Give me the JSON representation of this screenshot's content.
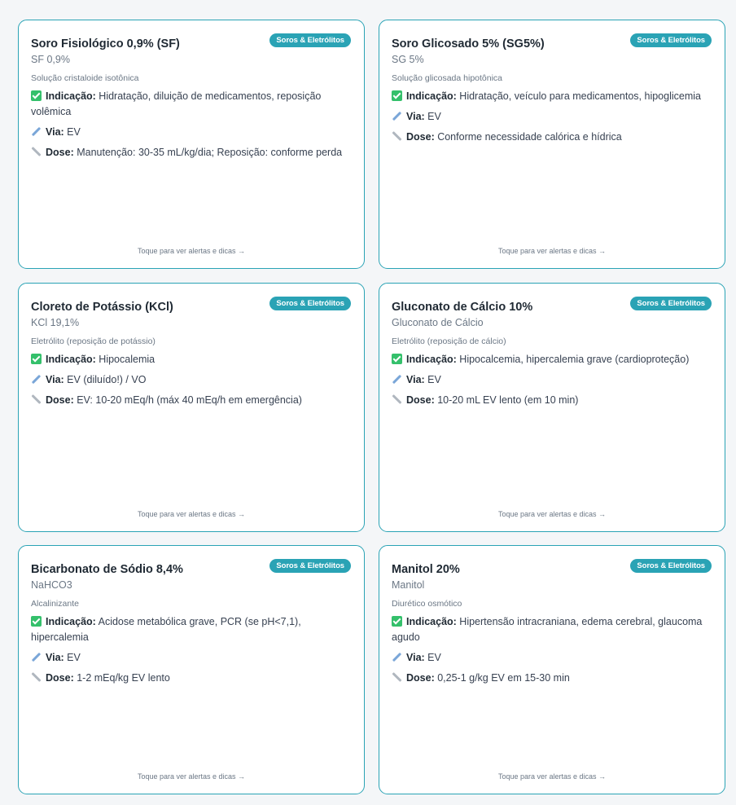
{
  "cards": [
    {
      "title": "Soro Fisiológico 0,9% (SF)",
      "badge": "Soros & Eletrólitos",
      "subtitle": "SF 0,9%",
      "class": "Solução cristaloide isotônica",
      "indication_label": "Indicação:",
      "indication": " Hidratação, diluição de medicamentos, reposição volêmica",
      "route_label": "Via:",
      "route": " EV",
      "dose_label": "Dose:",
      "dose": " Manutenção: 30-35 mL/kg/dia; Reposição: conforme perda",
      "footer": "Toque para ver alertas e dicas →"
    },
    {
      "title": "Soro Glicosado 5% (SG5%)",
      "badge": "Soros & Eletrólitos",
      "subtitle": "SG 5%",
      "class": "Solução glicosada hipotônica",
      "indication_label": "Indicação:",
      "indication": " Hidratação, veículo para medicamentos, hipoglicemia",
      "route_label": "Via:",
      "route": " EV",
      "dose_label": "Dose:",
      "dose": " Conforme necessidade calórica e hídrica",
      "footer": "Toque para ver alertas e dicas →"
    },
    {
      "title": "Cloreto de Potássio (KCl)",
      "badge": "Soros & Eletrólitos",
      "subtitle": "KCl 19,1%",
      "class": "Eletrólito (reposição de potássio)",
      "indication_label": "Indicação:",
      "indication": " Hipocalemia",
      "route_label": "Via:",
      "route": " EV (diluído!) / VO",
      "dose_label": "Dose:",
      "dose": " EV: 10-20 mEq/h (máx 40 mEq/h em emergência)",
      "footer": "Toque para ver alertas e dicas →"
    },
    {
      "title": "Gluconato de Cálcio 10%",
      "badge": "Soros & Eletrólitos",
      "subtitle": "Gluconato de Cálcio",
      "class": "Eletrólito (reposição de cálcio)",
      "indication_label": "Indicação:",
      "indication": " Hipocalcemia, hipercalemia grave (cardioproteção)",
      "route_label": "Via:",
      "route": " EV",
      "dose_label": "Dose:",
      "dose": " 10-20 mL EV lento (em 10 min)",
      "footer": "Toque para ver alertas e dicas →"
    },
    {
      "title": "Bicarbonato de Sódio 8,4%",
      "badge": "Soros & Eletrólitos",
      "subtitle": "NaHCO3",
      "class": "Alcalinizante",
      "indication_label": "Indicação:",
      "indication": " Acidose metabólica grave, PCR (se pH<7,1), hipercalemia",
      "route_label": "Via:",
      "route": " EV",
      "dose_label": "Dose:",
      "dose": " 1-2 mEq/kg EV lento",
      "footer": "Toque para ver alertas e dicas →"
    },
    {
      "title": "Manitol 20%",
      "badge": "Soros & Eletrólitos",
      "subtitle": "Manitol",
      "class": "Diurético osmótico",
      "indication_label": "Indicação:",
      "indication": " Hipertensão intracraniana, edema cerebral, glaucoma agudo",
      "route_label": "Via:",
      "route": " EV",
      "dose_label": "Dose:",
      "dose": " 0,25-1 g/kg EV em 15-30 min",
      "footer": "Toque para ver alertas e dicas →"
    }
  ],
  "colors": {
    "accent": "#2aa3b5",
    "check": "#34c06b",
    "syringe": "#7aa6d8",
    "ruler": "#b0b7bf"
  },
  "icons": [
    "check-icon",
    "syringe-icon",
    "ruler-icon"
  ]
}
